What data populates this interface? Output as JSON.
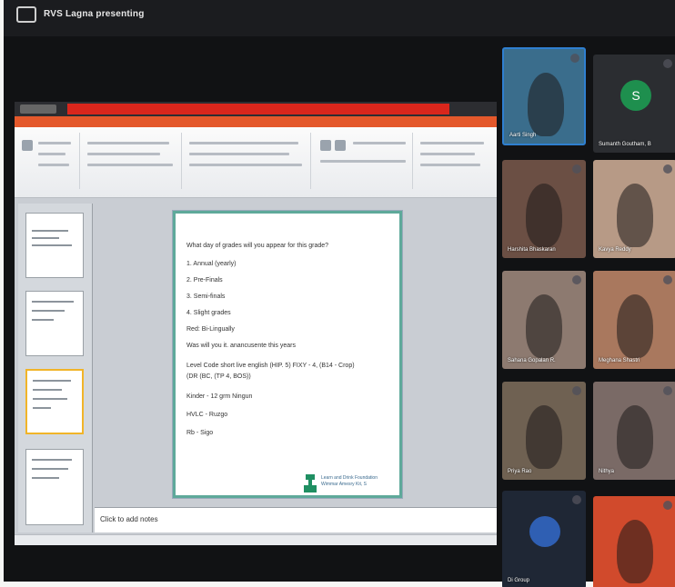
{
  "meeting": {
    "presenter_label": "RVS Lagna presenting"
  },
  "ppt": {
    "notes_placeholder": "Click to add notes",
    "slide_lines": [
      "What day of grades will you appear for this grade?",
      "1. Annual (yearly)",
      "2. Pre-Finals",
      "3. Semi-finals",
      "4. Slight grades",
      "Red: Bi-Lingually",
      "Was will you it. anancusente this years",
      "Level Code short live english (HIP. 5) FIXY - 4, (B14 - Crop)",
      "(DR (BC, (TP 4, BOS))",
      "Kinder - 12 grm Ningun",
      "HVLC - Ruzgo",
      "Rb - Sigo"
    ],
    "slide_logo_text": [
      "Learn and Drink Foundation",
      "Wimmar Amesry Kit, S"
    ]
  },
  "participants": [
    {
      "name": "Aarti Singh",
      "initial": "",
      "bg": "#3a6d8c"
    },
    {
      "name": "Sumanth Goutham, B",
      "initial": "S",
      "bg": "#2b2d31",
      "avatar_color": "#1e8f4e"
    },
    {
      "name": "Harshita Bhaskaran",
      "initial": "",
      "bg": "#6b4f44"
    },
    {
      "name": "Kavya Reddy",
      "initial": "",
      "bg": "#b79a86"
    },
    {
      "name": "Sahana Gopalan R.",
      "initial": "",
      "bg": "#8d7a70"
    },
    {
      "name": "Meghana Shastri",
      "initial": "",
      "bg": "#a9785e"
    },
    {
      "name": "Priya Rao",
      "initial": "",
      "bg": "#6f6152"
    },
    {
      "name": "Nithya",
      "initial": "",
      "bg": "#7a6a66"
    },
    {
      "name": "Di Group",
      "initial": "",
      "bg": "#1f2735",
      "avatar_color": "#2f5fb3"
    },
    {
      "name": "",
      "initial": "",
      "bg": "#d14a2c"
    }
  ]
}
